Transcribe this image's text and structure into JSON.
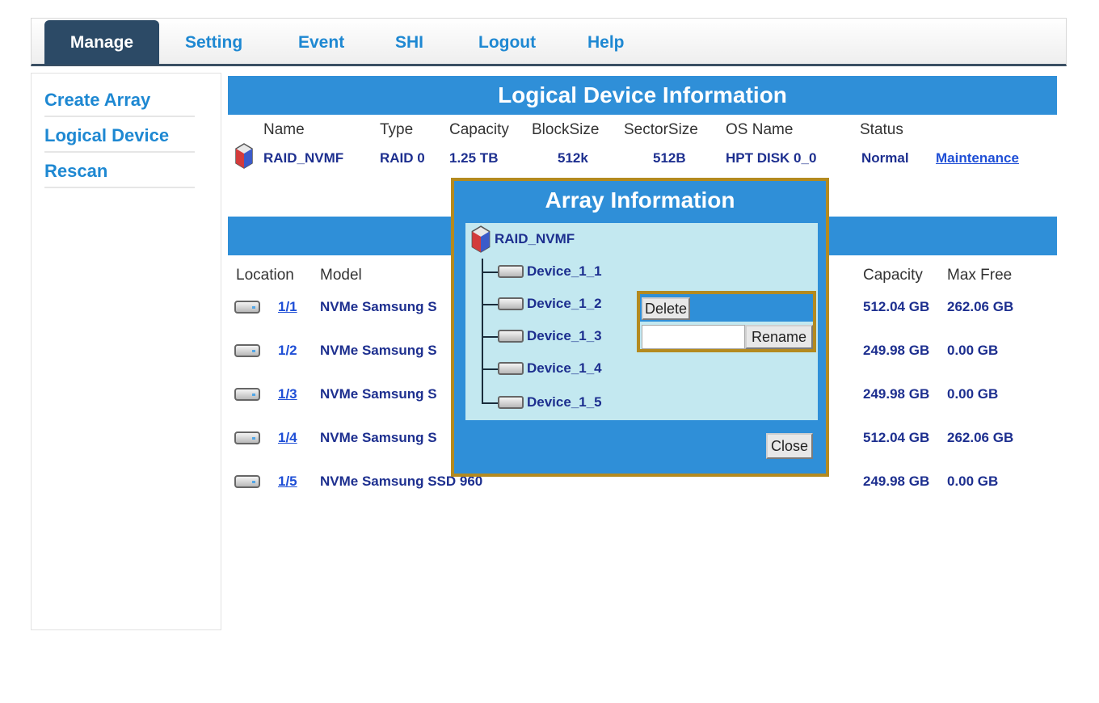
{
  "tabs": [
    {
      "label": "Manage",
      "active": true
    },
    {
      "label": "Setting"
    },
    {
      "label": "Event"
    },
    {
      "label": "SHI"
    },
    {
      "label": "Logout"
    },
    {
      "label": "Help"
    }
  ],
  "sidebar": {
    "items": [
      {
        "label": "Create Array"
      },
      {
        "label": "Logical Device"
      },
      {
        "label": "Rescan"
      }
    ]
  },
  "logical": {
    "title": "Logical Device Information",
    "headers": [
      "Name",
      "Type",
      "Capacity",
      "BlockSize",
      "SectorSize",
      "OS Name",
      "Status"
    ],
    "row": {
      "name": "RAID_NVMF",
      "type": "RAID 0",
      "capacity": "1.25 TB",
      "blocksize": "512k",
      "sectorsize": "512B",
      "osname": "HPT DISK 0_0",
      "status": "Normal",
      "action": "Maintenance"
    }
  },
  "physical": {
    "headers": {
      "location": "Location",
      "model": "Model",
      "capacity": "Capacity",
      "maxfree": "Max Free"
    },
    "rows": [
      {
        "location": "1/1",
        "model": "NVMe Samsung S",
        "capacity": "512.04 GB",
        "maxfree": "262.06 GB",
        "linked": true
      },
      {
        "location": "1/2",
        "model": "NVMe Samsung S",
        "capacity": "249.98 GB",
        "maxfree": "0.00 GB",
        "linked": false
      },
      {
        "location": "1/3",
        "model": "NVMe Samsung S",
        "capacity": "249.98 GB",
        "maxfree": "0.00 GB",
        "linked": true
      },
      {
        "location": "1/4",
        "model": "NVMe Samsung S",
        "capacity": "512.04 GB",
        "maxfree": "262.06 GB",
        "linked": true
      },
      {
        "location": "1/5",
        "model": "NVMe Samsung SSD 960",
        "capacity": "249.98 GB",
        "maxfree": "0.00 GB",
        "linked": true
      }
    ]
  },
  "modal": {
    "title": "Array Information",
    "root": "RAID_NVMF",
    "devices": [
      "Device_1_1",
      "Device_1_2",
      "Device_1_3",
      "Device_1_4",
      "Device_1_5"
    ],
    "delete_label": "Delete",
    "rename_label": "Rename",
    "rename_value": "",
    "close_label": "Close"
  },
  "colors": {
    "accent": "#2f8fd8",
    "tab_active": "#2c4a66",
    "link": "#1e88d2",
    "modal_border": "#b48a1f",
    "panel": "#c3e8f0"
  }
}
